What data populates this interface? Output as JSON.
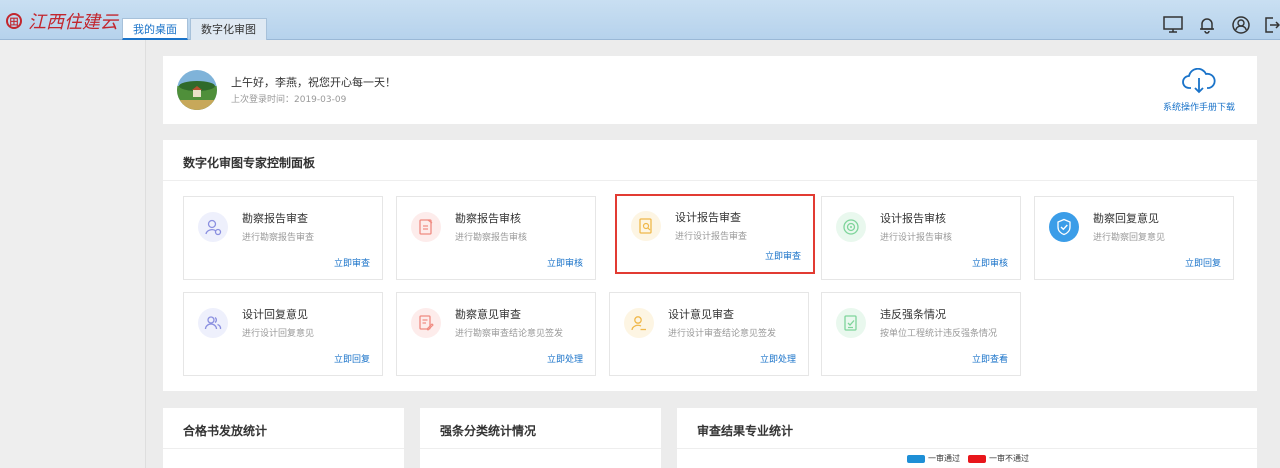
{
  "app": {
    "logo_mark": "田",
    "title": "江西住建云",
    "tabs": [
      {
        "label": "我的桌面",
        "active": true
      },
      {
        "label": "数字化审图",
        "active": false
      }
    ]
  },
  "header_icons": [
    "monitor-icon",
    "bell-icon",
    "user-circle-icon",
    "logout-icon"
  ],
  "welcome": {
    "greeting": "上午好，李燕，祝您开心每一天！",
    "last_login": "上次登录时间：2019-03-09",
    "download_label": "系统操作手册下载"
  },
  "panel": {
    "title": "数字化审图专家控制面板",
    "tiles": [
      {
        "title": "勘察报告审查",
        "desc": "进行勘察报告审查",
        "action": "立即审查",
        "icon": "user-gear-icon",
        "color": "#8a8fe0",
        "bg": "#eef0fc"
      },
      {
        "title": "勘察报告审核",
        "desc": "进行勘察报告审核",
        "action": "立即审核",
        "icon": "document-edit-icon",
        "color": "#f08a80",
        "bg": "#fdeceb"
      },
      {
        "title": "设计报告审查",
        "desc": "进行设计报告审查",
        "action": "立即审查",
        "icon": "document-search-icon",
        "color": "#f0b84a",
        "bg": "#fdf5e3",
        "highlight": true
      },
      {
        "title": "设计报告审核",
        "desc": "进行设计报告审核",
        "action": "立即审核",
        "icon": "target-icon",
        "color": "#7ed49a",
        "bg": "#e9f8ee"
      },
      {
        "title": "勘察回复意见",
        "desc": "进行勘察回复意见",
        "action": "立即回复",
        "icon": "shield-check-icon",
        "color": "#3b9de8",
        "bg": "#ddeefb"
      },
      {
        "title": "设计回复意见",
        "desc": "进行设计回复意见",
        "action": "立即回复",
        "icon": "users-icon",
        "color": "#8a8fe0",
        "bg": "#eef0fc"
      },
      {
        "title": "勘察意见审查",
        "desc": "进行勘察审查结论意见签发",
        "action": "立即处理",
        "icon": "document-sign-icon",
        "color": "#f08a80",
        "bg": "#fdeceb"
      },
      {
        "title": "设计意见审查",
        "desc": "进行设计审查结论意见签发",
        "action": "立即处理",
        "icon": "user-edit-icon",
        "color": "#f0b84a",
        "bg": "#fdf5e3"
      },
      {
        "title": "违反强条情况",
        "desc": "按单位工程统计违反强条情况",
        "action": "立即查看",
        "icon": "checklist-icon",
        "color": "#7ed49a",
        "bg": "#e9f8ee"
      }
    ]
  },
  "stats": [
    {
      "title": "合格书发放统计"
    },
    {
      "title": "强条分类统计情况"
    },
    {
      "title": "审查结果专业统计",
      "legend": [
        {
          "label": "一审通过",
          "color": "#1e8fd6"
        },
        {
          "label": "一审不通过",
          "color": "#e8161b"
        }
      ]
    }
  ]
}
